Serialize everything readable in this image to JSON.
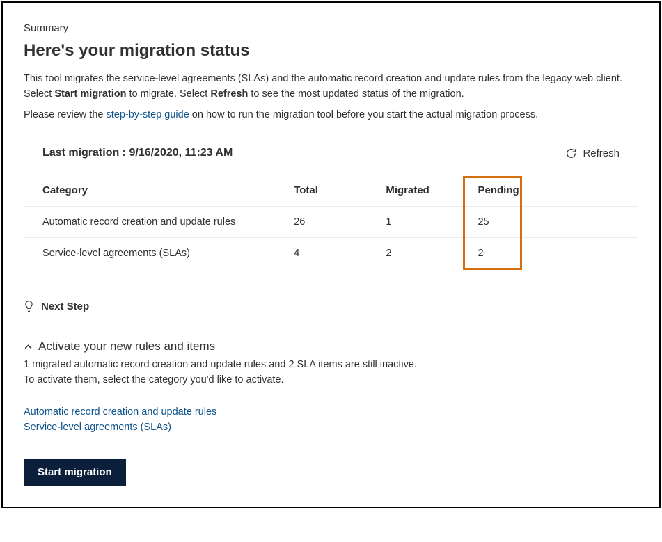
{
  "summary_label": "Summary",
  "page_title": "Here's your migration status",
  "intro": {
    "line1_prefix": "This tool migrates the service-level agreements (SLAs) and the automatic record creation and update rules from the legacy web client. Select ",
    "bold1": "Start migration",
    "mid1": " to migrate. Select ",
    "bold2": "Refresh",
    "suffix1": " to see the most updated status of the migration.",
    "line2_prefix": "Please review the ",
    "guide_link": "step-by-step guide",
    "line2_suffix": " on how to run the migration tool before you start the actual migration process."
  },
  "card": {
    "last_migration_label": "Last migration : 9/16/2020, 11:23 AM",
    "refresh_label": "Refresh"
  },
  "table": {
    "headers": {
      "category": "Category",
      "total": "Total",
      "migrated": "Migrated",
      "pending": "Pending"
    },
    "rows": [
      {
        "category": "Automatic record creation and update rules",
        "total": "26",
        "migrated": "1",
        "pending": "25"
      },
      {
        "category": "Service-level agreements (SLAs)",
        "total": "4",
        "migrated": "2",
        "pending": "2"
      }
    ]
  },
  "next_step": {
    "label": "Next Step"
  },
  "activate": {
    "title": "Activate your new rules and items",
    "body_line1": "1 migrated automatic record creation and update rules and 2 SLA items are still inactive.",
    "body_line2": "To activate them, select the category you'd like to activate.",
    "link_arc": "Automatic record creation and update rules",
    "link_sla": "Service-level agreements (SLAs)"
  },
  "start_button": "Start migration"
}
